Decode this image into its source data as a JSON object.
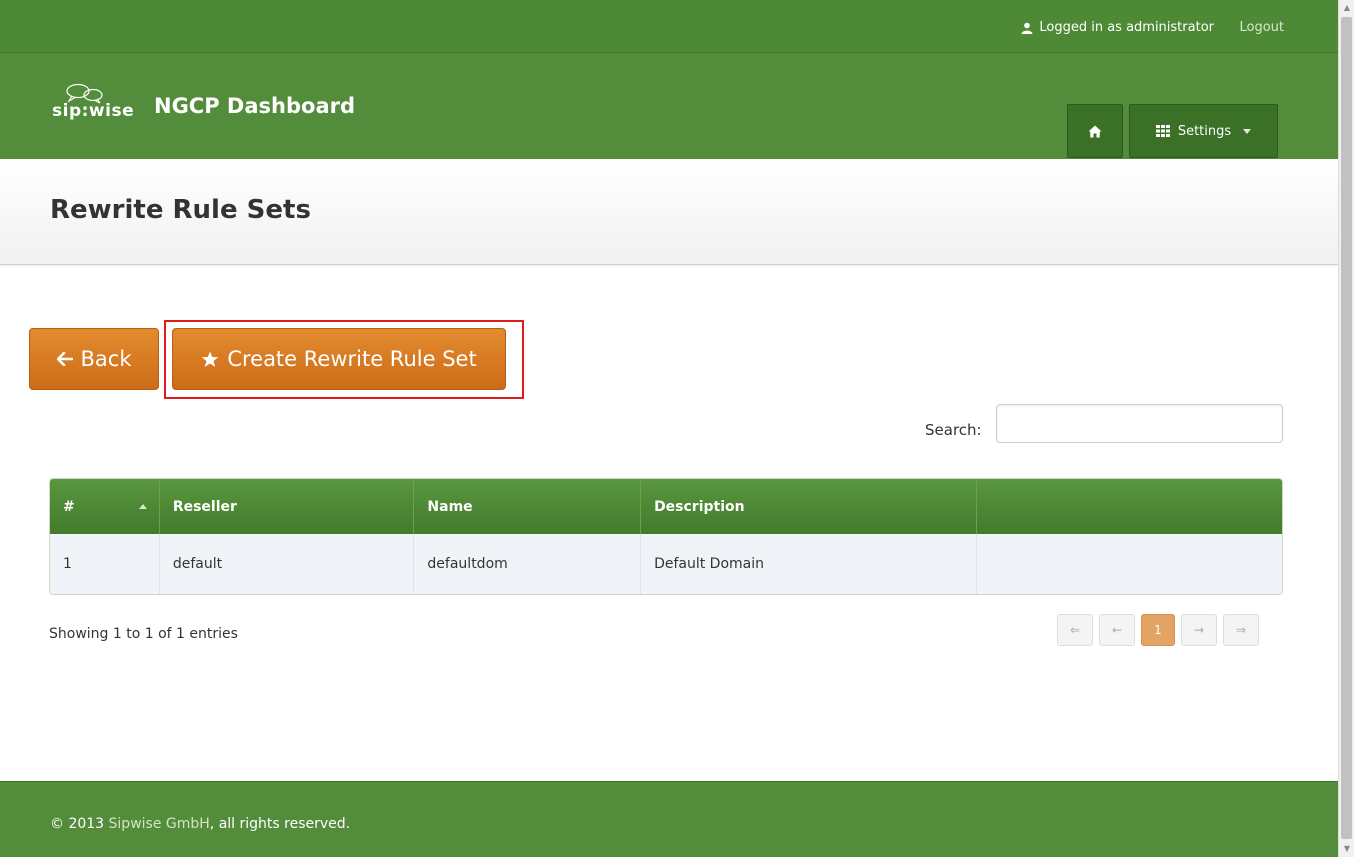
{
  "topbar": {
    "logged_in_text": "Logged in as administrator",
    "logout_label": "Logout"
  },
  "brand": {
    "logo_text": "sip:wise",
    "title": "NGCP Dashboard"
  },
  "nav": {
    "settings_label": "Settings"
  },
  "page": {
    "title": "Rewrite Rule Sets"
  },
  "actions": {
    "back_label": "Back",
    "create_label": "Create Rewrite Rule Set"
  },
  "search": {
    "label": "Search:",
    "value": ""
  },
  "table": {
    "columns": [
      "#",
      "Reseller",
      "Name",
      "Description",
      ""
    ],
    "rows": [
      [
        "1",
        "default",
        "defaultdom",
        "Default Domain",
        ""
      ]
    ],
    "sorted_column": "#",
    "sort_direction": "asc"
  },
  "status": {
    "showing_text": "Showing 1 to 1 of 1 entries"
  },
  "pagination": {
    "first": "⇐",
    "prev": "←",
    "current": "1",
    "next": "→",
    "last": "⇒"
  },
  "footer": {
    "copyright_prefix": "© 2013 ",
    "company_link": "Sipwise GmbH",
    "copyright_suffix": ", all rights reserved."
  },
  "colors": {
    "header_green": "#538c3a",
    "button_orange": "#d9781f",
    "highlight_red": "#e01b1b",
    "row_background": "#f0f3f8"
  }
}
